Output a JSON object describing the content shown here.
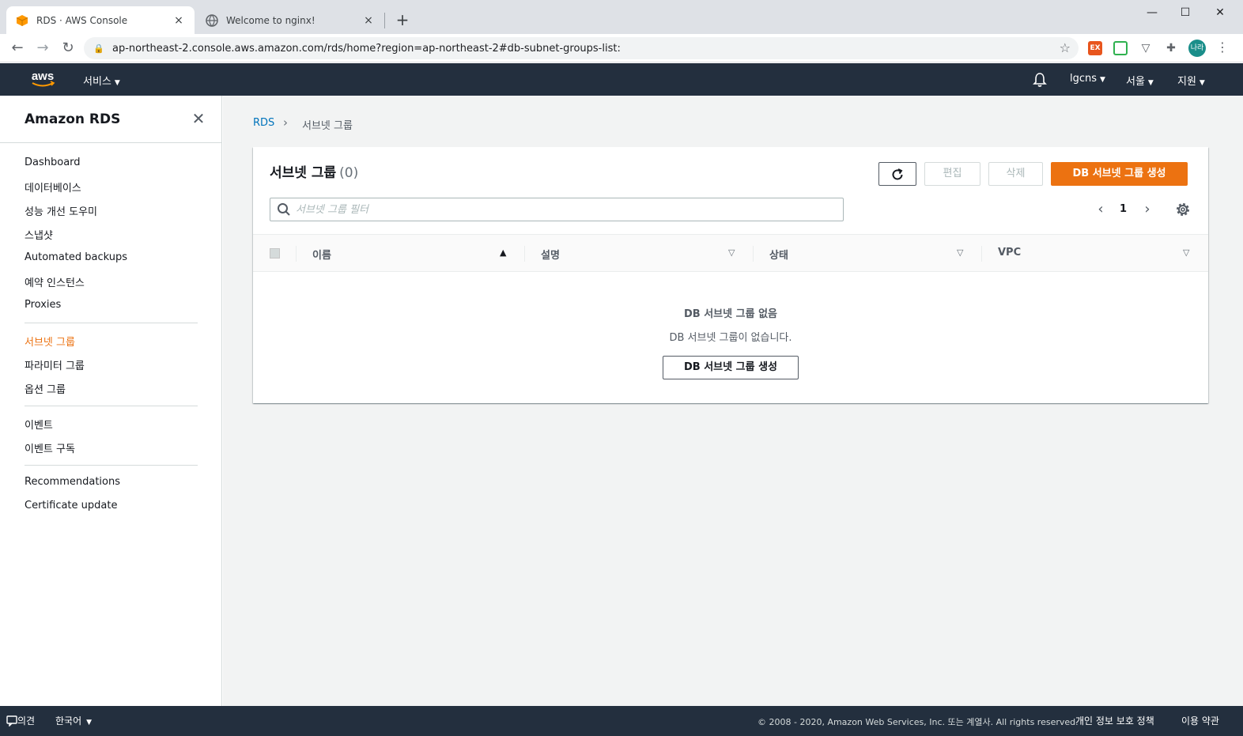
{
  "browser": {
    "tabs": [
      {
        "title": "RDS · AWS Console",
        "close": "×"
      },
      {
        "title": "Welcome to nginx!",
        "close": "×"
      }
    ],
    "new_tab": "+",
    "url": "ap-northeast-2.console.aws.amazon.com/rds/home?region=ap-northeast-2#db-subnet-groups-list:",
    "profile_initials": "나라",
    "ext_label": "EX",
    "window_controls": {
      "minimize": "—",
      "maximize": "☐",
      "close": "✕"
    }
  },
  "awsnav": {
    "logo_text": "aws",
    "services": "서비스",
    "account": "lgcns",
    "region": "서울",
    "support": "지원"
  },
  "sidebar": {
    "title": "Amazon RDS",
    "groups": [
      [
        "Dashboard",
        "데이터베이스",
        "성능 개선 도우미",
        "스냅샷",
        "Automated backups",
        "예약 인스턴스",
        "Proxies"
      ],
      [
        "서브넷 그룹",
        "파라미터 그룹",
        "옵션 그룹"
      ],
      [
        "이벤트",
        "이벤트 구독"
      ],
      [
        "Recommendations",
        "Certificate update"
      ]
    ],
    "active_item": "서브넷 그룹"
  },
  "breadcrumb": {
    "root": "RDS",
    "current": "서브넷 그룹"
  },
  "panel": {
    "title": "서브넷 그룹",
    "count": "(0)",
    "buttons": {
      "edit": "편집",
      "delete": "삭제",
      "create": "DB 서브넷 그룹 생성"
    },
    "search_placeholder": "서브넷 그룹 필터",
    "page": "1",
    "columns": [
      "이름",
      "설명",
      "상태",
      "VPC"
    ],
    "empty_title": "DB 서브넷 그룹 없음",
    "empty_desc": "DB 서브넷 그룹이 없습니다.",
    "empty_create": "DB 서브넷 그룹 생성"
  },
  "footer": {
    "feedback": "의견",
    "language": "한국어",
    "copyright": "© 2008 - 2020, Amazon Web Services, Inc. 또는 계열사. All rights reserved.",
    "privacy": "개인 정보 보호 정책",
    "terms": "이용 약관"
  },
  "colors": {
    "accent": "#ec7211",
    "nav_bg": "#232f3e",
    "link": "#0073bb"
  }
}
